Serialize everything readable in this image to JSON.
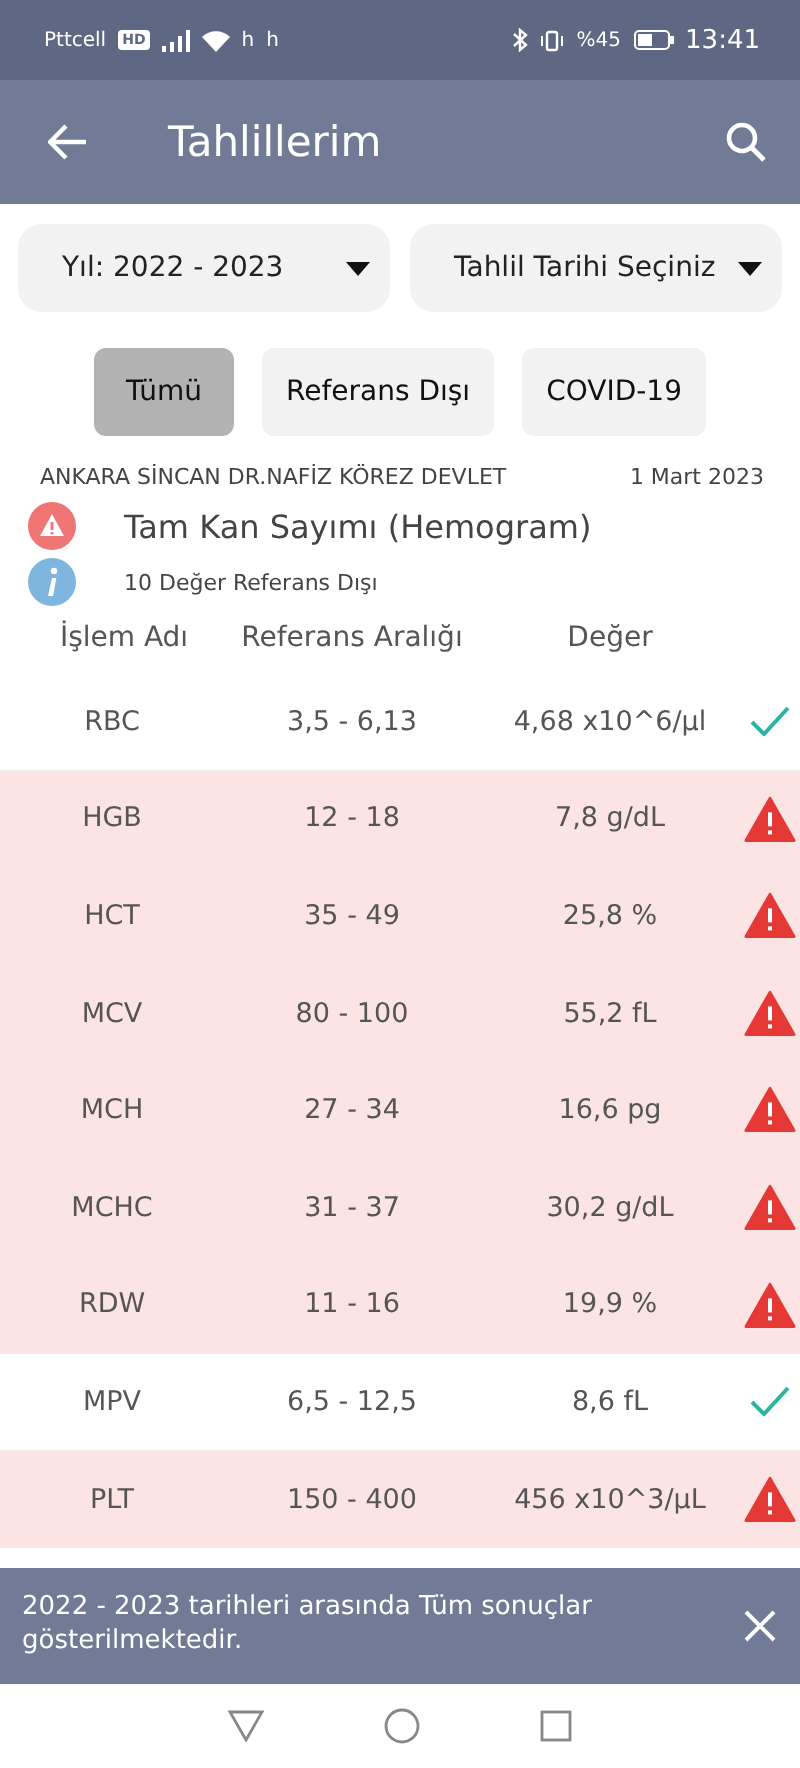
{
  "status_bar": {
    "carrier": "Pttcell",
    "network_badge": "HD",
    "indicators": [
      "h",
      "h"
    ],
    "battery_percent": "%45",
    "time": "13:41"
  },
  "app_bar": {
    "title": "Tahlillerim"
  },
  "filters": [
    {
      "label": "Yıl: 2022 - 2023"
    },
    {
      "label": "Tahlil Tarihi Seçiniz"
    }
  ],
  "chips": [
    {
      "label": "Tümü",
      "selected": true
    },
    {
      "label": "Referans Dışı",
      "selected": false
    },
    {
      "label": "COVID-19",
      "selected": false
    }
  ],
  "report": {
    "hospital": "ANKARA SİNCAN DR.NAFİZ KÖREZ DEVLET",
    "date": "1 Mart 2023",
    "test_name": "Tam Kan Sayımı (Hemogram)",
    "summary": "10 Değer Referans Dışı"
  },
  "table": {
    "columns": [
      "İşlem Adı",
      "Referans Aralığı",
      "Değer"
    ],
    "rows": [
      {
        "name": "RBC",
        "range": "3,5 - 6,13",
        "value": "4,68 x10^6/µl",
        "out_of_range": false
      },
      {
        "name": "HGB",
        "range": "12 - 18",
        "value": "7,8 g/dL",
        "out_of_range": true
      },
      {
        "name": "HCT",
        "range": "35 - 49",
        "value": "25,8 %",
        "out_of_range": true
      },
      {
        "name": "MCV",
        "range": "80 - 100",
        "value": "55,2 fL",
        "out_of_range": true
      },
      {
        "name": "MCH",
        "range": "27 - 34",
        "value": "16,6 pg",
        "out_of_range": true
      },
      {
        "name": "MCHC",
        "range": "31 - 37",
        "value": "30,2 g/dL",
        "out_of_range": true
      },
      {
        "name": "RDW",
        "range": "11 - 16",
        "value": "19,9 %",
        "out_of_range": true
      },
      {
        "name": "MPV",
        "range": "6,5 - 12,5",
        "value": "8,6 fL",
        "out_of_range": false
      },
      {
        "name": "PLT",
        "range": "150 - 400",
        "value": "456 x10^3/µL",
        "out_of_range": true
      }
    ]
  },
  "snackbar": {
    "message": "2022 - 2023 tarihleri arasında Tüm sonuçlar gösterilmektedir."
  }
}
